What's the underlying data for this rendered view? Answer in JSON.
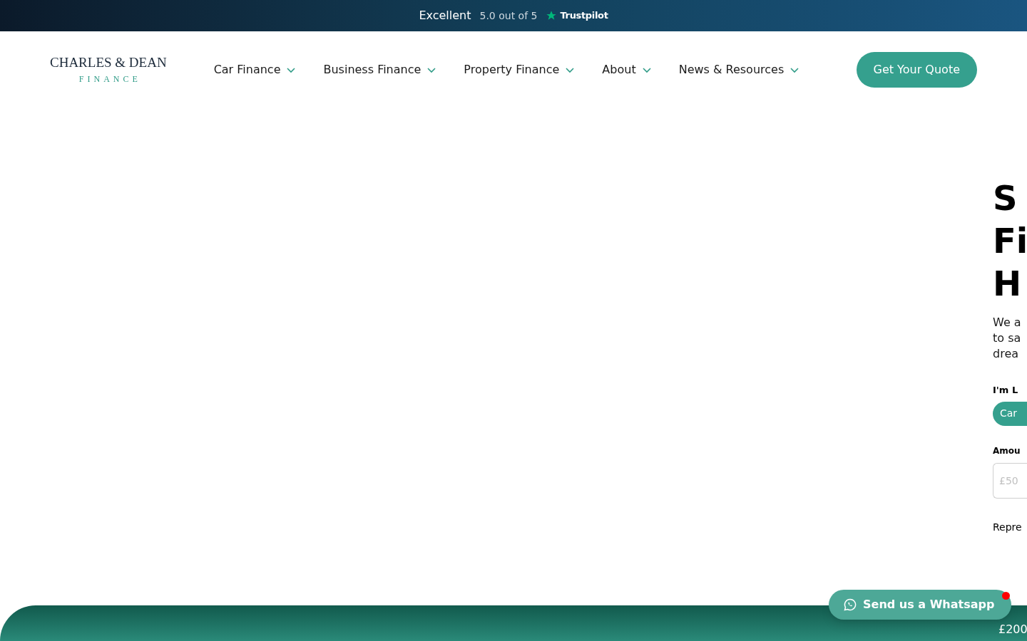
{
  "rating_bar": {
    "label": "Excellent",
    "score": "5.0 out of 5",
    "brand": "Trustpilot"
  },
  "logo": {
    "name": "CHARLES & DEAN",
    "sub": "FINANCE"
  },
  "nav": [
    {
      "label": "Car Finance"
    },
    {
      "label": "Business Finance"
    },
    {
      "label": "Property Finance"
    },
    {
      "label": "About"
    },
    {
      "label": "News & Resources"
    }
  ],
  "cta": "Get Your Quote",
  "hero": {
    "headline": [
      "S",
      "Fi",
      "H"
    ],
    "intro": [
      "We a",
      "to sa",
      "drea"
    ],
    "looking_label": "I'm L",
    "option": {
      "label": "Car",
      "selected": true
    },
    "amount_label": "Amou",
    "amount_placeholder": "£50",
    "representative": "Repre"
  },
  "whatsapp": {
    "label": "Send us a Whatsapp",
    "notification": true
  },
  "band": {
    "text": "£200"
  }
}
